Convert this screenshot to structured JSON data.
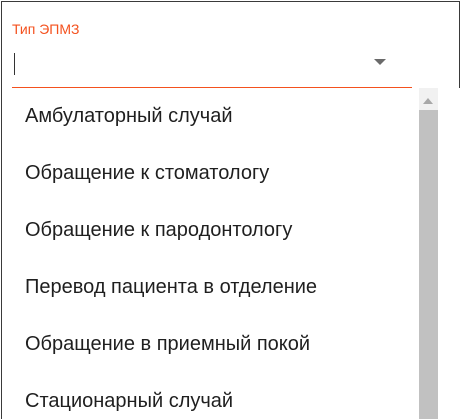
{
  "field": {
    "label": "Тип ЭПМЗ",
    "value": ""
  },
  "options": [
    "Амбулаторный случай",
    "Обращение к стоматологу",
    "Обращение к пародонтологу",
    "Перевод пациента в отделение",
    "Обращение в приемный покой",
    "Стационарный случай"
  ],
  "colors": {
    "accent": "#f4511e",
    "text": "#1f1f1f",
    "scroll_track": "#f1f1f1",
    "scroll_thumb": "#c1c1c1"
  }
}
